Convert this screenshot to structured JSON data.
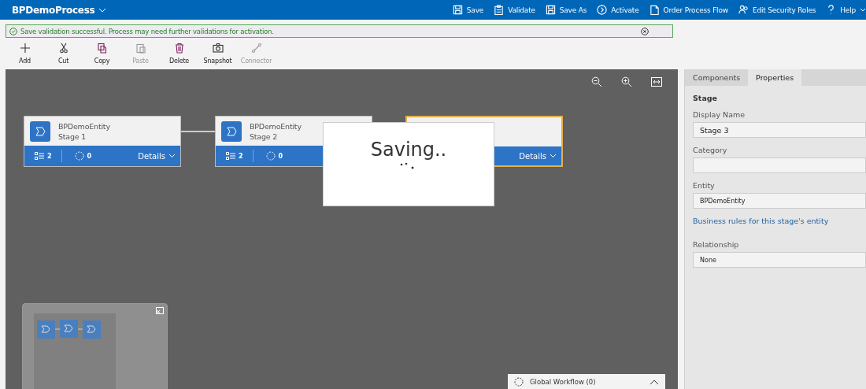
{
  "header": {
    "title": "BPDemoProcess",
    "commands": [
      {
        "label": "Save"
      },
      {
        "label": "Validate"
      },
      {
        "label": "Save As"
      },
      {
        "label": "Activate"
      },
      {
        "label": "Order Process Flow"
      },
      {
        "label": "Edit Security Roles"
      },
      {
        "label": "Help"
      }
    ]
  },
  "notification": {
    "message": "Save validation successful. Process may need further validations for activation."
  },
  "toolbar": [
    {
      "label": "Add",
      "disabled": false
    },
    {
      "label": "Cut",
      "disabled": false
    },
    {
      "label": "Copy",
      "disabled": false
    },
    {
      "label": "Paste",
      "disabled": true
    },
    {
      "label": "Delete",
      "disabled": false
    },
    {
      "label": "Snapshot",
      "disabled": false
    },
    {
      "label": "Connector",
      "disabled": true
    }
  ],
  "stages": [
    {
      "entity": "BPDemoEntity",
      "name": "Stage 1",
      "steps": "2",
      "workflows": "0",
      "details": "Details",
      "selected": false
    },
    {
      "entity": "BPDemoEntity",
      "name": "Stage 2",
      "steps": "2",
      "workflows": "0",
      "selected": false
    },
    {
      "details": "Details",
      "selected": true
    }
  ],
  "saving": {
    "text": "Saving.."
  },
  "global_workflow": {
    "label": "Global Workflow (0)"
  },
  "panel": {
    "tabs": [
      {
        "label": "Components",
        "selected": false
      },
      {
        "label": "Properties",
        "selected": true
      }
    ],
    "heading": "Stage",
    "fields": [
      {
        "label": "Display Name",
        "value": "Stage 3"
      },
      {
        "label": "Category"
      },
      {
        "label": "Entity",
        "value": "BPDemoEntity"
      }
    ],
    "link": "Business rules for this stage's entity",
    "relationship": {
      "label": "Relationship",
      "value": "None"
    }
  }
}
